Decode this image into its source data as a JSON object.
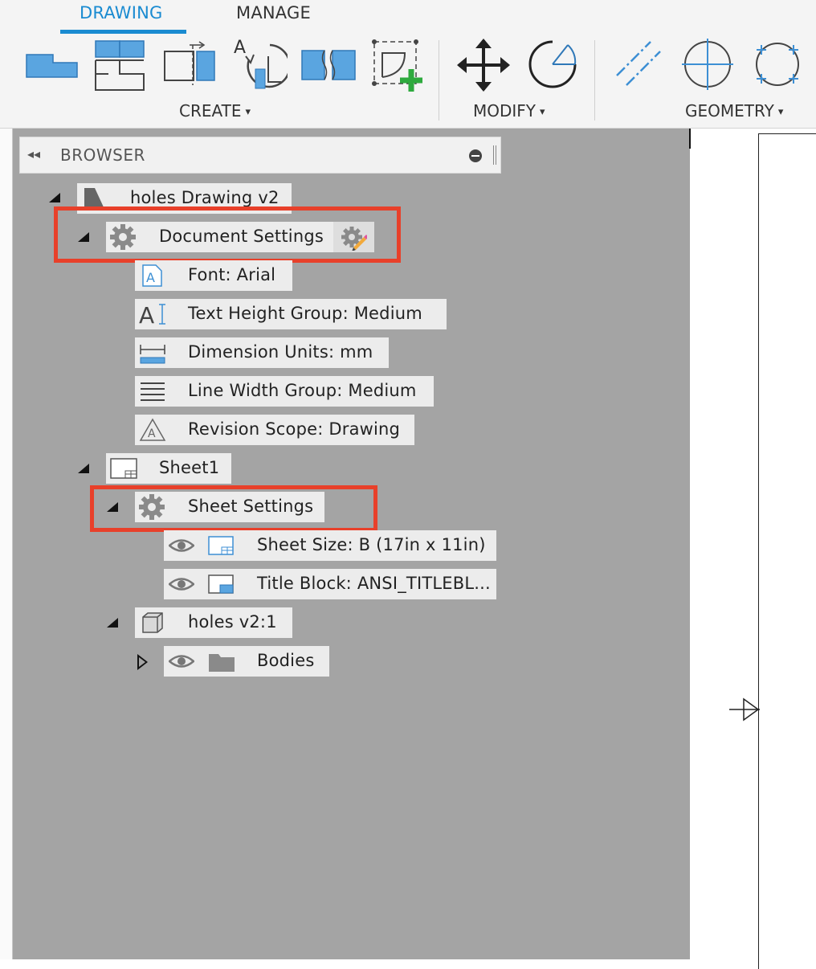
{
  "toolbar": {
    "tabs": [
      {
        "label": "DRAWING",
        "active": true
      },
      {
        "label": "MANAGE",
        "active": false
      }
    ],
    "groups": [
      {
        "label": "CREATE"
      },
      {
        "label": "MODIFY"
      },
      {
        "label": "GEOMETRY"
      }
    ],
    "caret": "▾",
    "accent_color": "#1a8bd1"
  },
  "browser": {
    "title": "BROWSER",
    "collapse_glyph": "◂◂",
    "tree": {
      "root": "holes Drawing v2",
      "document_settings": "Document Settings",
      "doc_items": [
        "Font: Arial",
        "Text Height Group: Medium",
        "Dimension Units: mm",
        "Line Width Group: Medium",
        "Revision Scope: Drawing"
      ],
      "sheet": "Sheet1",
      "sheet_settings": "Sheet Settings",
      "sheet_items": [
        "Sheet Size: B (17in x 11in)",
        "Title Block: ANSI_TITLEBL..."
      ],
      "component": "holes v2:1",
      "bodies": "Bodies"
    }
  },
  "highlight_color": "#e8402a"
}
